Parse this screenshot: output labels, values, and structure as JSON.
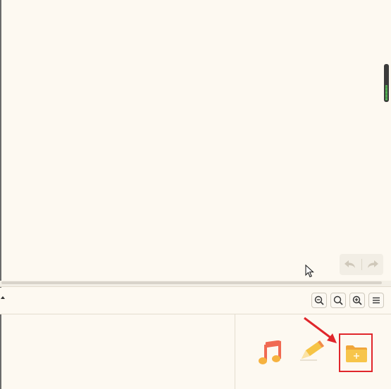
{
  "editor": {
    "undo_label": "",
    "redo_label": ""
  },
  "toolbar": {
    "buttons": [
      {
        "icon": "zoom-out-icon"
      },
      {
        "icon": "zoom-fit-icon"
      },
      {
        "icon": "zoom-in-icon"
      },
      {
        "icon": "menu-icon"
      }
    ]
  },
  "apps": [
    {
      "icon": "music-note-icon",
      "color": "#f2a23a"
    },
    {
      "icon": "pencil-icon",
      "color": "#f5b93c"
    },
    {
      "icon": "folder-add-icon",
      "color": "#f6bf3e",
      "highlighted": true
    }
  ],
  "annotation": {
    "highlight_color": "#e0262b"
  },
  "colors": {
    "background": "#fdf9f1",
    "scroll_thumb": "#3b3b3b"
  }
}
